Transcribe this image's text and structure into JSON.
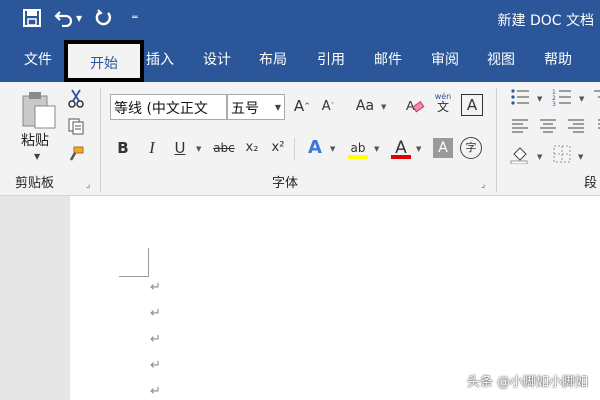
{
  "window": {
    "title": "新建 DOC 文档"
  },
  "quick_access": {
    "save_icon": "save-icon",
    "undo_icon": "undo-icon",
    "redo_icon": "redo-icon",
    "customize_icon": "customize-qat-icon"
  },
  "tabs": [
    {
      "label": "文件"
    },
    {
      "label": "开始",
      "active": true
    },
    {
      "label": "插入"
    },
    {
      "label": "设计"
    },
    {
      "label": "布局"
    },
    {
      "label": "引用"
    },
    {
      "label": "邮件"
    },
    {
      "label": "审阅"
    },
    {
      "label": "视图"
    },
    {
      "label": "帮助"
    }
  ],
  "ribbon": {
    "clipboard": {
      "label": "剪贴板",
      "paste_label": "粘贴"
    },
    "font": {
      "label": "字体",
      "font_name": "等线 (中文正文",
      "font_size": "五号",
      "change_case": "Aa",
      "bold": "B",
      "italic": "I",
      "underline": "U",
      "strikethrough": "abc",
      "subscript": "x₂",
      "superscript": "x²",
      "text_effects": "A",
      "highlight": "ab",
      "font_color": "A",
      "char_shading": "A",
      "enclose": "字",
      "phonetic_top": "wén",
      "phonetic_bottom": "文",
      "char_border": "A"
    },
    "paragraph": {
      "label": "段"
    }
  },
  "colors": {
    "brand": "#2b579a",
    "ribbon_bg": "#f3f3f3",
    "highlight_yellow": "#ffff00",
    "font_red": "#e00000"
  }
}
